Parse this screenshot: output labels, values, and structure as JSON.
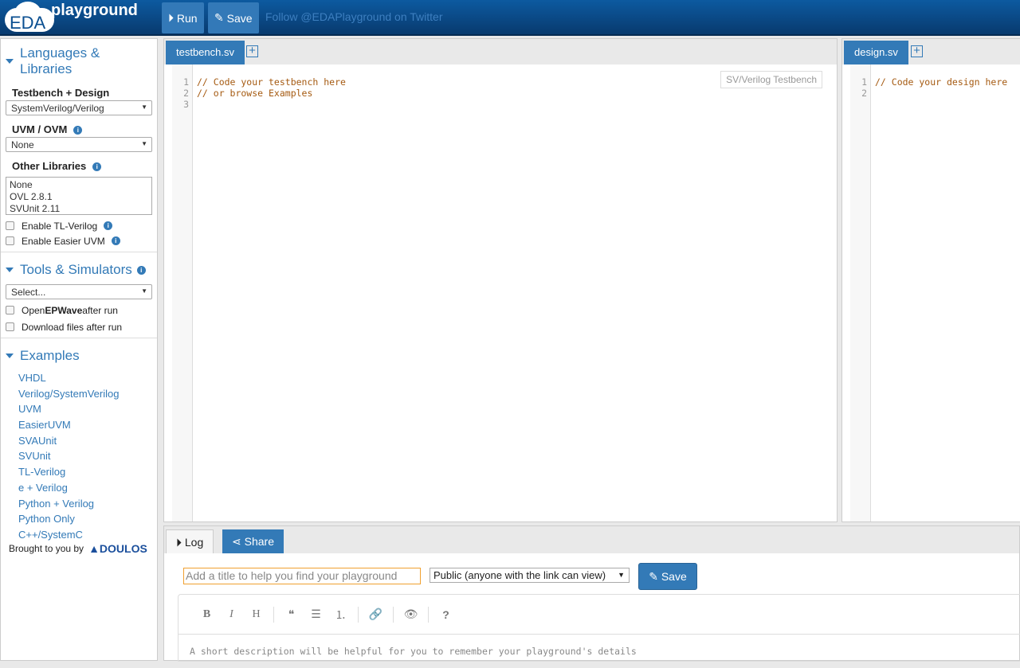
{
  "header": {
    "logo_eda": "EDA",
    "logo_playground": "playground",
    "run": "Run",
    "save": "Save",
    "follow": "Follow @EDAPlayground on Twitter"
  },
  "sidebar": {
    "languages_title": "Languages & Libraries",
    "testbench_label": "Testbench + Design",
    "testbench_value": "SystemVerilog/Verilog",
    "uvm_label": "UVM / OVM",
    "uvm_value": "None",
    "other_label": "Other Libraries",
    "other_options": [
      "None",
      "OVL 2.8.1",
      "SVUnit 2.11"
    ],
    "tl_verilog": "Enable TL-Verilog",
    "easier_uvm": "Enable Easier UVM",
    "tools_title": "Tools & Simulators",
    "tools_value": "Select...",
    "open_epwave_pre": "Open ",
    "open_epwave_bold": "EPWave",
    "open_epwave_post": " after run",
    "download": "Download files after run",
    "examples_title": "Examples",
    "examples": [
      "VHDL",
      "Verilog/SystemVerilog",
      "UVM",
      "EasierUVM",
      "SVAUnit",
      "SVUnit",
      "TL-Verilog",
      "e + Verilog",
      "Python + Verilog",
      "Python Only",
      "C++/SystemC"
    ],
    "brought": "Brought to you by",
    "doulos": "DOULOS"
  },
  "testbench": {
    "tab": "testbench.sv",
    "lines": [
      "1",
      "2",
      "3"
    ],
    "code": "// Code your testbench here\n// or browse Examples",
    "hint": "SV/Verilog Testbench"
  },
  "design": {
    "tab": "design.sv",
    "lines": [
      "1",
      "2"
    ],
    "code": "// Code your design here"
  },
  "bottom": {
    "log": "Log",
    "share": "Share",
    "title_placeholder": "Add a title to help you find your playground",
    "visibility": "Public (anyone with the link can view)",
    "save": "Save",
    "toolbar": [
      "B",
      "I",
      "H",
      "❝",
      "☰",
      "⒈",
      "🔗",
      "👁",
      "?"
    ],
    "description_placeholder": "A short description will be helpful for you to remember your playground's details"
  }
}
